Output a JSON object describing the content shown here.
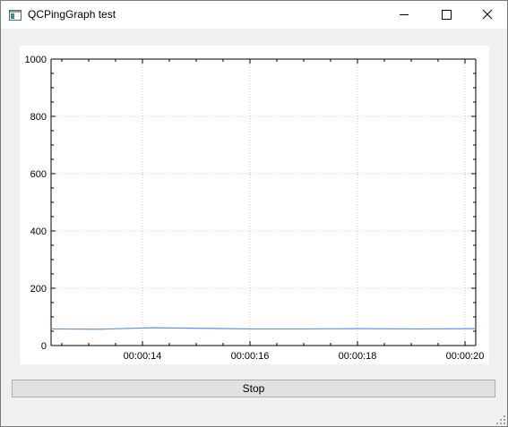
{
  "window": {
    "title": "QCPingGraph test",
    "icon": "app-window-icon",
    "controls": [
      "minimize-icon",
      "maximize-icon",
      "close-icon"
    ]
  },
  "chart_data": {
    "type": "line",
    "title": "",
    "xlabel": "",
    "ylabel": "",
    "x_tick_labels": [
      "00:00:14",
      "00:00:16",
      "00:00:18",
      "00:00:20"
    ],
    "x_ticks_seconds": [
      14,
      16,
      18,
      20
    ],
    "xlim_seconds": [
      12.3,
      20.2
    ],
    "ylim": [
      0,
      1000
    ],
    "y_tick_labels": [
      "0",
      "200",
      "400",
      "600",
      "800",
      "1000"
    ],
    "y_ticks": [
      0,
      200,
      400,
      600,
      800,
      1000
    ],
    "grid": true,
    "series": [
      {
        "color": "#6a8fd8",
        "x": [
          12.3,
          13.2,
          14.2,
          16.0,
          17.0,
          18.0,
          19.1,
          20.2
        ],
        "y": [
          58,
          57,
          62,
          58,
          58,
          59,
          58,
          59
        ]
      }
    ]
  },
  "controls": {
    "stop_label": "Stop"
  }
}
